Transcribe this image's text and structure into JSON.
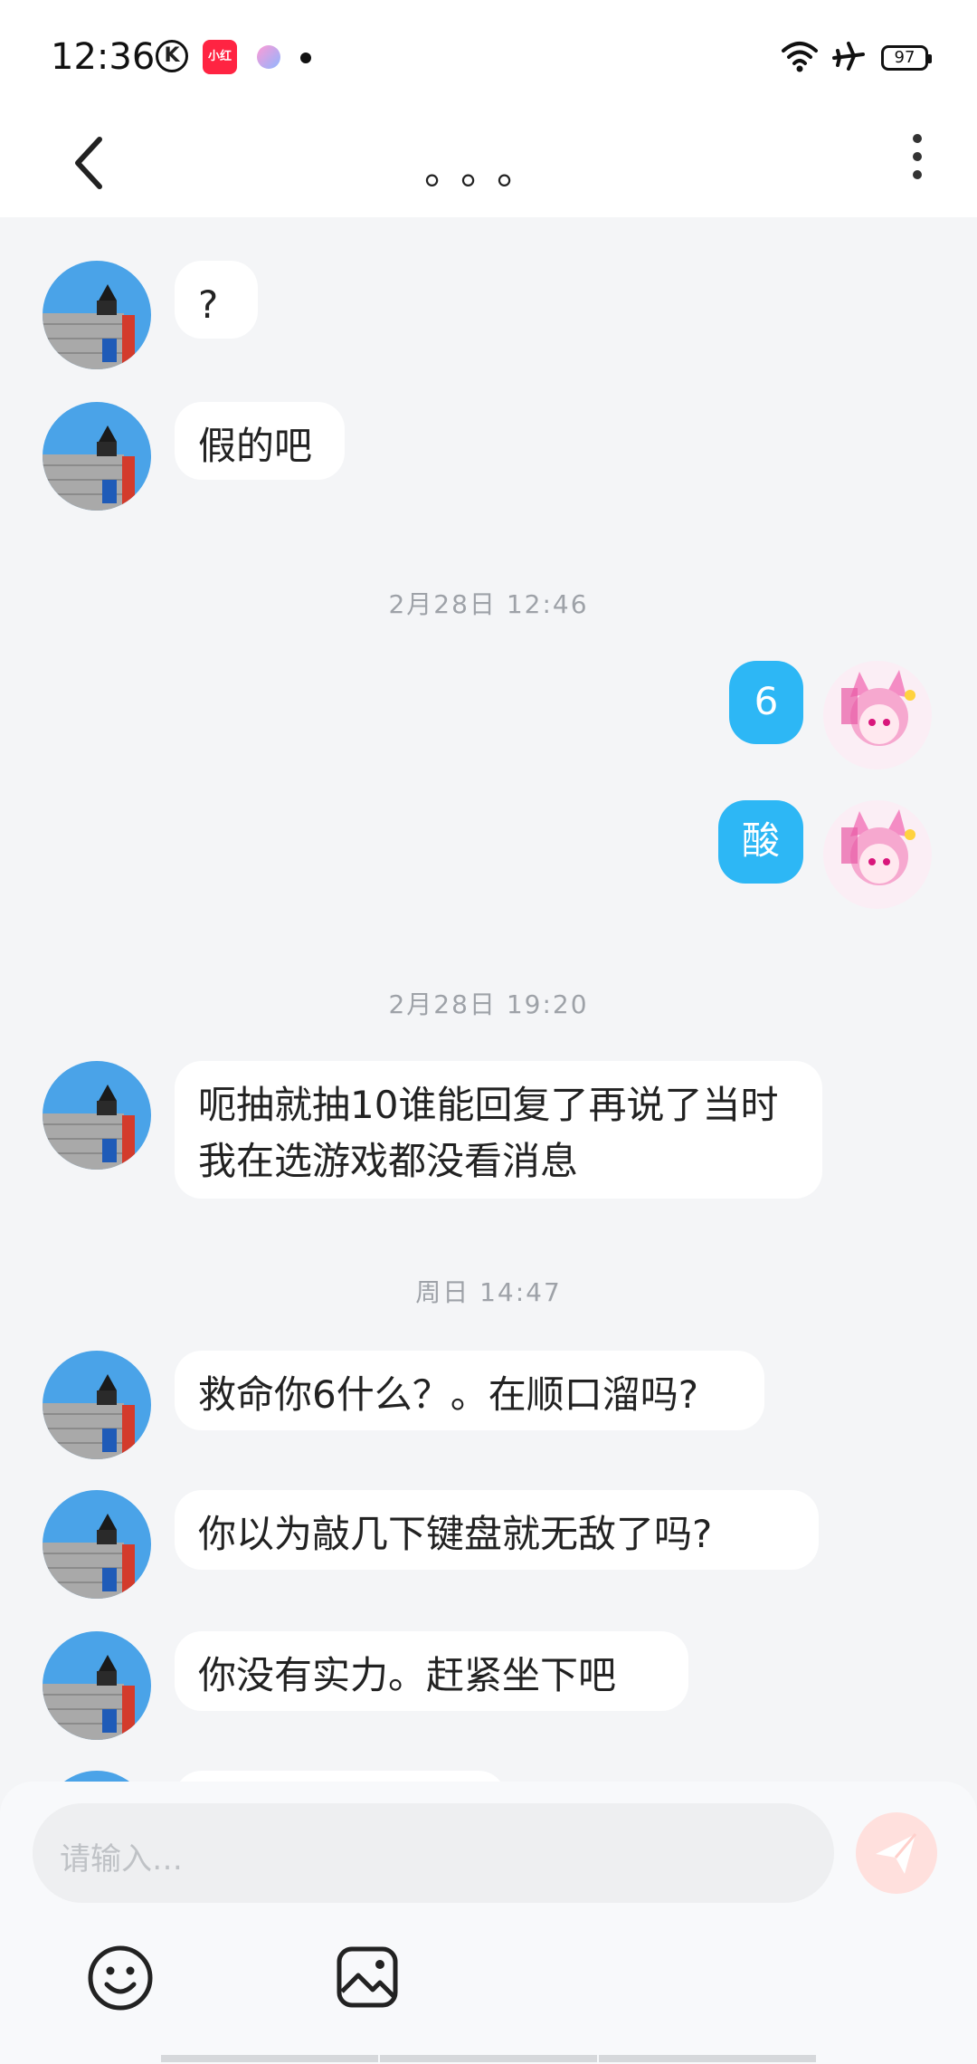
{
  "status_bar": {
    "time": "12:36",
    "k_icon": "K",
    "xhs_icon": "小红书",
    "battery": "97",
    "icons": [
      "k-app-icon",
      "xiaohongshu-icon",
      "app-icon",
      "dot-icon",
      "wifi-icon",
      "airplane-icon",
      "battery-icon"
    ]
  },
  "header": {
    "title": "。。。",
    "back_icon": "chevron-left-icon",
    "more_icon": "more-vertical-icon"
  },
  "messages": [
    {
      "type": "msg",
      "sender": "other",
      "text": "?"
    },
    {
      "type": "msg",
      "sender": "other",
      "text": "假的吧"
    },
    {
      "type": "time",
      "text": "2月28日 12:46"
    },
    {
      "type": "msg",
      "sender": "me",
      "text": "6"
    },
    {
      "type": "msg",
      "sender": "me",
      "text": "酸"
    },
    {
      "type": "time",
      "text": "2月28日 19:20"
    },
    {
      "type": "msg",
      "sender": "other",
      "text": "呃抽就抽10谁能回复了再说了当时我在选游戏都没看消息"
    },
    {
      "type": "time",
      "text": "周日 14:47"
    },
    {
      "type": "msg",
      "sender": "other",
      "text": "救命你6什么？。在顺口溜吗?"
    },
    {
      "type": "msg",
      "sender": "other",
      "text": "你以为敲几下键盘就无敌了吗?"
    },
    {
      "type": "msg",
      "sender": "other",
      "text": "你没有实力。赶紧坐下吧"
    }
  ],
  "input": {
    "placeholder": "请输入…",
    "send_icon": "send-icon",
    "emoji_icon": "emoji-icon",
    "image_icon": "image-icon"
  },
  "colors": {
    "accent": "#2db7f5",
    "background": "#f4f5f7",
    "bubble": "#ffffff"
  }
}
